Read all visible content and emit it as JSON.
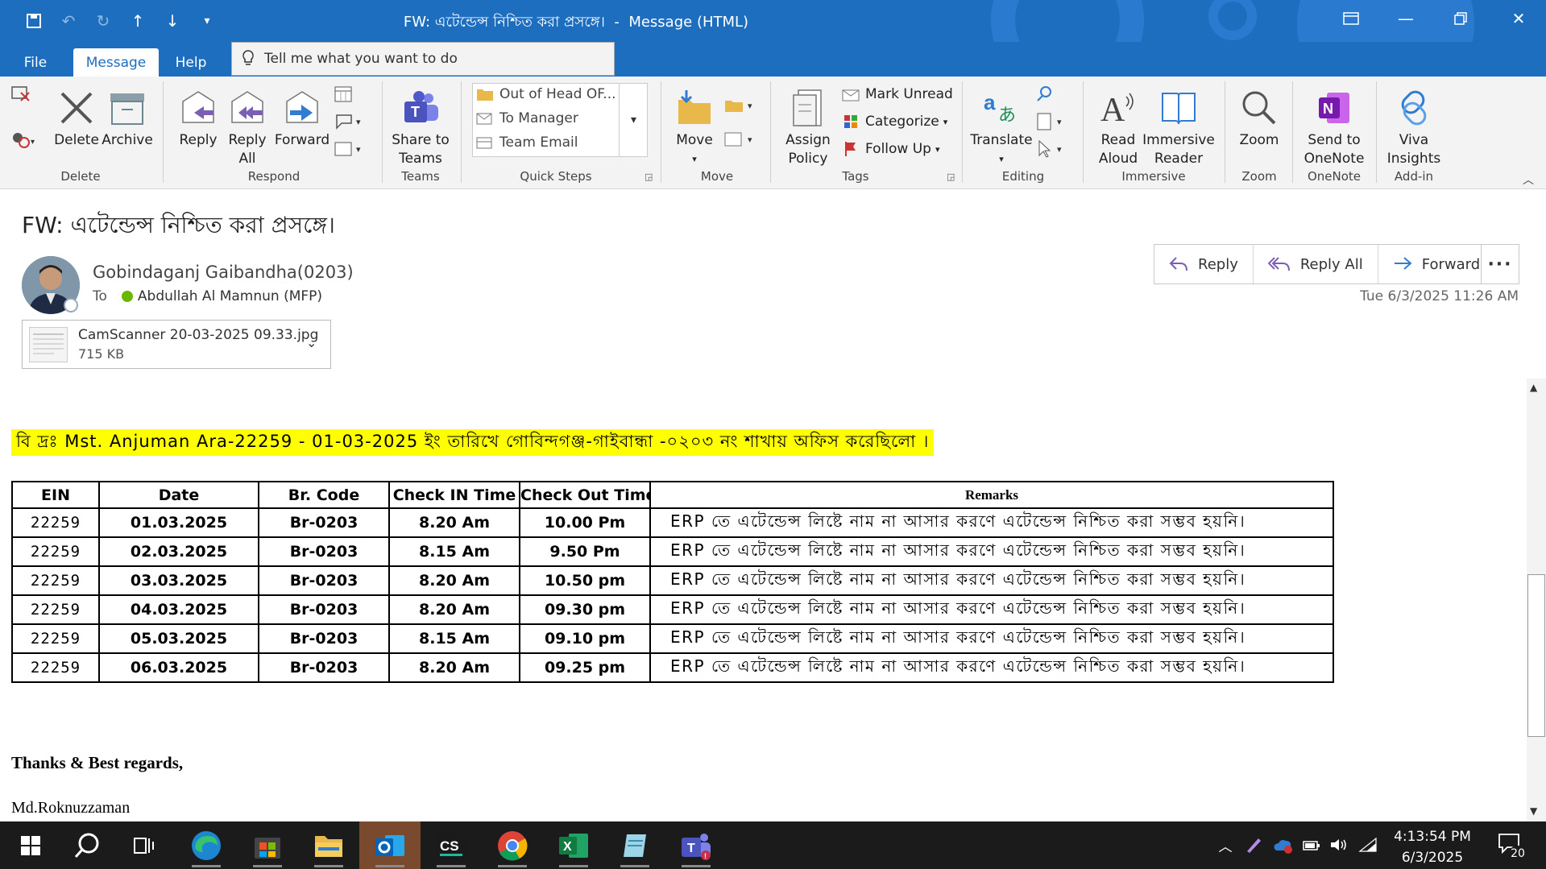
{
  "window": {
    "title": "FW: এটেন্ডেন্স নিশ্চিত করা প্রসঙ্গে।  -  Message (HTML)"
  },
  "menu": {
    "tabs": [
      {
        "label": "File"
      },
      {
        "label": "Message"
      },
      {
        "label": "Help"
      }
    ],
    "tell_me": "Tell me what you want to do"
  },
  "ribbon": {
    "delete": {
      "delete": "Delete",
      "archive": "Archive",
      "group": "Delete"
    },
    "respond": {
      "reply": "Reply",
      "reply_all": "Reply\nAll",
      "forward": "Forward",
      "group": "Respond"
    },
    "teams": {
      "share": "Share to\nTeams",
      "group": "Teams"
    },
    "quick_steps": {
      "items": [
        "Out of Head OF...",
        "To Manager",
        "Team Email"
      ],
      "group": "Quick Steps"
    },
    "move": {
      "move": "Move",
      "group": "Move"
    },
    "tags": {
      "assign_policy": "Assign\nPolicy",
      "mark_unread": "Mark Unread",
      "categorize": "Categorize",
      "follow_up": "Follow Up",
      "group": "Tags"
    },
    "editing": {
      "translate": "Translate",
      "group": "Editing"
    },
    "immersive": {
      "read_aloud": "Read\nAloud",
      "immersive_reader": "Immersive\nReader",
      "group": "Immersive"
    },
    "zoom": {
      "zoom": "Zoom",
      "group": "Zoom"
    },
    "onenote": {
      "send": "Send to\nOneNote",
      "group": "OneNote"
    },
    "addin": {
      "viva": "Viva\nInsights",
      "group": "Add-in"
    }
  },
  "message": {
    "subject": "FW: এটেন্ডেন্স নিশ্চিত করা প্রসঙ্গে।",
    "sender": "Gobindaganj Gaibandha(0203)",
    "to_label": "To",
    "recipient": "Abdullah Al Mamnun (MFP)",
    "date": "Tue 6/3/2025 11:26 AM",
    "attachment": {
      "name": "CamScanner 20-03-2025 09.33.jpg",
      "size": "715 KB"
    },
    "actions": {
      "reply": "Reply",
      "reply_all": "Reply All",
      "forward": "Forward"
    }
  },
  "body": {
    "note": "বি দ্রঃ Mst. Anjuman Ara-22259 - 01-03-2025 ইং তারিখে গোবিন্দগঞ্জ-গাইবান্ধা -০২০৩ নং শাখায় অফিস করেছিলো ।",
    "table": {
      "headers": [
        "EIN",
        "Date",
        "Br. Code",
        "Check IN Time",
        "Check Out Time",
        "Remarks"
      ],
      "rows": [
        [
          "22259",
          "01.03.2025",
          "Br-0203",
          "8.20 Am",
          "10.00 Pm",
          "ERP তে এটেন্ডেন্স লিষ্টে নাম না আসার করণে এটেন্ডেন্স নিশ্চিত করা সম্ভব হয়নি।"
        ],
        [
          "22259",
          "02.03.2025",
          "Br-0203",
          "8.15 Am",
          "9.50 Pm",
          "ERP তে এটেন্ডেন্স লিষ্টে নাম না আসার করণে এটেন্ডেন্স নিশ্চিত করা সম্ভব হয়নি।"
        ],
        [
          "22259",
          "03.03.2025",
          "Br-0203",
          "8.20 Am",
          "10.50 pm",
          "ERP তে এটেন্ডেন্স লিষ্টে নাম না আসার করণে এটেন্ডেন্স নিশ্চিত করা সম্ভব হয়নি।"
        ],
        [
          "22259",
          "04.03.2025",
          "Br-0203",
          "8.20 Am",
          "09.30 pm",
          "ERP তে এটেন্ডেন্স লিষ্টে নাম না আসার করণে এটেন্ডেন্স নিশ্চিত করা সম্ভব হয়নি।"
        ],
        [
          "22259",
          "05.03.2025",
          "Br-0203",
          "8.15  Am",
          "09.10 pm",
          "ERP তে এটেন্ডেন্স লিষ্টে নাম না আসার করণে এটেন্ডেন্স নিশ্চিত করা সম্ভব হয়নি।"
        ],
        [
          "22259",
          "06.03.2025",
          "Br-0203",
          "8.20 Am",
          "09.25 pm",
          "ERP তে এটেন্ডেন্স লিষ্টে নাম না আসার করণে এটেন্ডেন্স নিশ্চিত করা সম্ভব হয়নি।"
        ]
      ]
    },
    "signoff": "Thanks & Best regards,",
    "signature": "Md.Roknuzzaman"
  },
  "taskbar": {
    "apps": [
      "start-icon",
      "search-icon",
      "task-view-icon",
      "edge-icon",
      "store-icon",
      "file-explorer-icon",
      "outlook-icon",
      "camscanner-icon",
      "chrome-icon",
      "excel-icon",
      "notepad-icon",
      "teams-icon"
    ],
    "clock_time": "4:13:54 PM",
    "clock_date": "6/3/2025",
    "notification_count": "20"
  },
  "colors": {
    "accent": "#1e6ec0",
    "highlight": "#ffff00",
    "taskbar": "#1b1b1b"
  }
}
